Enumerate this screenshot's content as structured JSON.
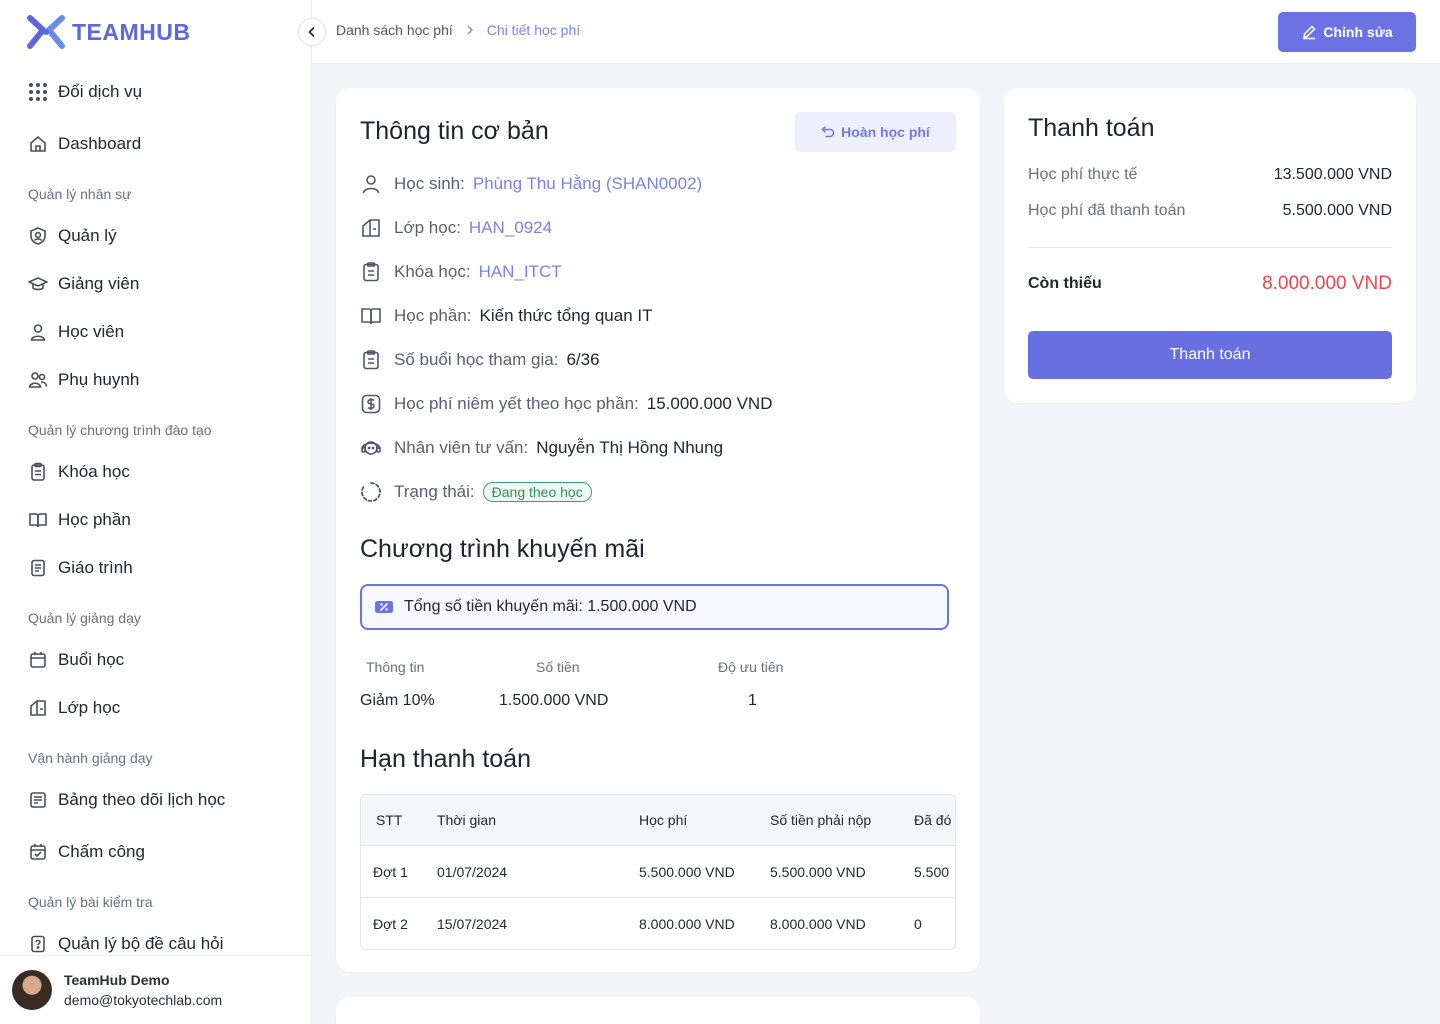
{
  "app": {
    "logo_text": "TEAMHUB"
  },
  "sidebar": {
    "switch_service": "Đổi dịch vụ",
    "dashboard": "Dashboard",
    "sections": [
      {
        "title": "Quản lý nhân sự",
        "items": [
          "Quản lý",
          "Giảng viên",
          "Học viên",
          "Phụ huynh"
        ]
      },
      {
        "title": "Quản lý chương trình đào tạo",
        "items": [
          "Khóa học",
          "Học phần",
          "Giáo trình"
        ]
      },
      {
        "title": "Quản lý giảng dạy",
        "items": [
          "Buổi học",
          "Lớp học"
        ]
      },
      {
        "title": "Vận hành giảng dạy",
        "items": [
          "Bảng theo dõi lịch học",
          "Chấm công"
        ]
      },
      {
        "title": "Quản lý bài kiểm tra",
        "items": [
          "Quản lý bộ đề câu hỏi"
        ]
      }
    ],
    "user": {
      "name": "TeamHub Demo",
      "email": "demo@tokyotechlab.com"
    }
  },
  "header": {
    "breadcrumb": [
      "Danh sách học phí",
      "Chi tiết học phí"
    ],
    "edit_label": "Chỉnh sửa"
  },
  "basic_info": {
    "title": "Thông tin cơ bản",
    "refund_label": "Hoàn học phí",
    "student_label": "Học sinh:",
    "student_value": "Phùng Thu Hằng (SHAN0002)",
    "class_label": "Lớp học:",
    "class_value": "HAN_0924",
    "course_label": "Khóa học:",
    "course_value": "HAN_ITCT",
    "module_label": "Học phần:",
    "module_value": "Kiến thức tổng quan IT",
    "sessions_label": "Số buổi học tham gia:",
    "sessions_value": "6/36",
    "listed_fee_label": "Học phí niêm yết theo học phần:",
    "listed_fee_value": "15.000.000 VND",
    "consultant_label": "Nhân viên tư vấn:",
    "consultant_value": "Nguyễn Thị Hồng Nhung",
    "status_label": "Trạng thái:",
    "status_value": "Đang theo học"
  },
  "promotion": {
    "title": "Chương trình khuyến mãi",
    "total": "Tổng số tiền khuyến mãi: 1.500.000  VND",
    "headers": [
      "Thông tin",
      "Số tiền",
      "Độ ưu tiên"
    ],
    "rows": [
      {
        "info": "Giảm 10%",
        "amount": "1.500.000 VND",
        "priority": "1"
      }
    ]
  },
  "deadline": {
    "title": "Hạn thanh toán",
    "headers": [
      "STT",
      "Thời gian",
      "Học phí",
      "Số tiền phải nộp",
      "Đã đó"
    ],
    "rows": [
      {
        "stt": "Đợt 1",
        "time": "01/07/2024",
        "fee": "5.500.000 VND",
        "due": "5.500.000 VND",
        "paid": "5.500"
      },
      {
        "stt": "Đợt 2",
        "time": "15/07/2024",
        "fee": "8.000.000 VND",
        "due": "8.000.000 VND",
        "paid": "0"
      }
    ]
  },
  "payment": {
    "title": "Thanh toán",
    "actual_fee_label": "Học phí thực tế",
    "actual_fee_value": "13.500.000 VND",
    "paid_label": "Học phí đã thanh toán",
    "paid_value": "5.500.000 VND",
    "remaining_label": "Còn thiếu",
    "remaining_value": "8.000.000 VND",
    "button_label": "Thanh toán"
  },
  "colors": {
    "accent": "#6b72e3",
    "danger": "#e5484d",
    "success": "#2e8f5c"
  }
}
